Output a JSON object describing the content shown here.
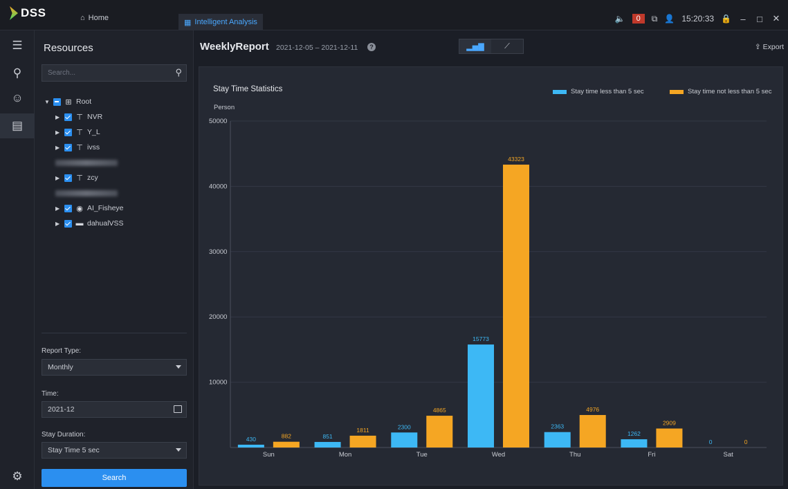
{
  "app": {
    "name": "DSS",
    "tabs": [
      {
        "label": "Home",
        "icon": "home-icon"
      },
      {
        "label": "Intelligent Analysis",
        "icon": "grid-icon"
      }
    ],
    "alarm_count": "0",
    "clock": "15:20:33"
  },
  "sidebar": {
    "icons": [
      "menu-icon",
      "person-track-icon",
      "face-icon",
      "report-icon",
      "settings-icon"
    ]
  },
  "resources": {
    "title": "Resources",
    "search_placeholder": "Search...",
    "tree": [
      {
        "label": "Root",
        "level": 0,
        "icon": "root-icon",
        "check": "partial",
        "arrow": "open"
      },
      {
        "label": "NVR",
        "level": 1,
        "icon": "org-icon",
        "check": "checked",
        "arrow": "closed"
      },
      {
        "label": "Y_L",
        "level": 1,
        "icon": "org-icon",
        "check": "checked",
        "arrow": "closed"
      },
      {
        "label": "ivss",
        "level": 1,
        "icon": "org-icon",
        "check": "checked",
        "arrow": "closed"
      },
      {
        "label": "",
        "level": 1,
        "icon": "",
        "check": "blurred",
        "arrow": "none"
      },
      {
        "label": "zcy",
        "level": 1,
        "icon": "org-icon",
        "check": "checked",
        "arrow": "closed"
      },
      {
        "label": "",
        "level": 1,
        "icon": "",
        "check": "blurred",
        "arrow": "none"
      },
      {
        "label": "AI_Fisheye",
        "level": 1,
        "icon": "camera-icon",
        "check": "checked",
        "arrow": "closed"
      },
      {
        "label": "dahualVSS",
        "level": 1,
        "icon": "server-icon",
        "check": "checked",
        "arrow": "closed"
      }
    ],
    "report_type_label": "Report Type:",
    "report_type_value": "Monthly",
    "time_label": "Time:",
    "time_value": "2021-12",
    "stay_duration_label": "Stay Duration:",
    "stay_duration_value": "Stay Time 5 sec",
    "search_button": "Search"
  },
  "main": {
    "title": "WeeklyReport",
    "date_range": "2021-12-05 – 2021-12-11",
    "export_label": "Export"
  },
  "chart_data": {
    "type": "bar",
    "title": "Stay Time Statistics",
    "ylabel": "Person",
    "xlabel": "",
    "categories": [
      "Sun",
      "Mon",
      "Tue",
      "Wed",
      "Thu",
      "Fri",
      "Sat"
    ],
    "series": [
      {
        "name": "Stay time less than 5 sec",
        "color": "#3db8f5",
        "values": [
          430,
          851,
          2300,
          15773,
          2363,
          1262,
          0
        ]
      },
      {
        "name": "Stay time not less than 5 sec",
        "color": "#f5a623",
        "values": [
          882,
          1811,
          4865,
          43323,
          4976,
          2909,
          0
        ]
      }
    ],
    "ylim": [
      0,
      50000
    ],
    "yticks": [
      10000,
      20000,
      30000,
      40000,
      50000
    ],
    "grid": true,
    "legend": "top-right"
  }
}
